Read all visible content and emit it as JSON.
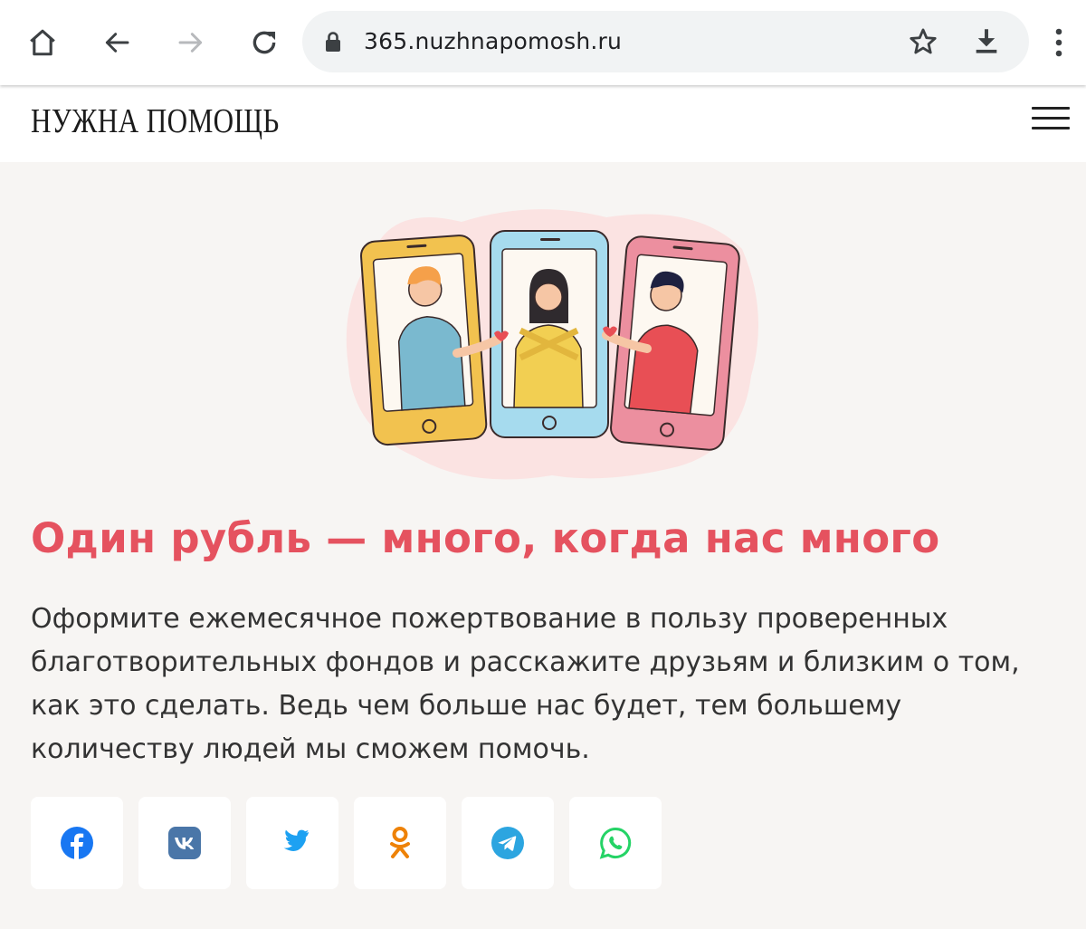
{
  "browser": {
    "url": "365.nuzhnapomosh.ru",
    "icons": [
      "home-icon",
      "back-icon",
      "forward-icon",
      "reload-icon",
      "lock-icon",
      "star-icon",
      "download-icon",
      "more-icon"
    ]
  },
  "site": {
    "logo": "НУЖНА ПОМОЩЬ",
    "menu_icon": "hamburger-icon"
  },
  "content": {
    "headline": "Один рубль — много, когда нас много",
    "lead": "Оформите ежемесячное пожертвование в пользу проверенных благотворительных фондов и расскажите друзьям и близким о том, как это сделать. Ведь чем больше нас будет, тем большему количеству людей мы сможем помочь."
  },
  "share": [
    {
      "name": "facebook",
      "color": "#1877f2"
    },
    {
      "name": "vk",
      "color": "#4a76a8"
    },
    {
      "name": "twitter",
      "color": "#1da1f2"
    },
    {
      "name": "odnoklassniki",
      "color": "#ee8208"
    },
    {
      "name": "telegram",
      "color": "#2ca5e0"
    },
    {
      "name": "whatsapp",
      "color": "#25d366"
    }
  ],
  "colors": {
    "accent": "#e5525f",
    "background": "#f7f5f3"
  }
}
